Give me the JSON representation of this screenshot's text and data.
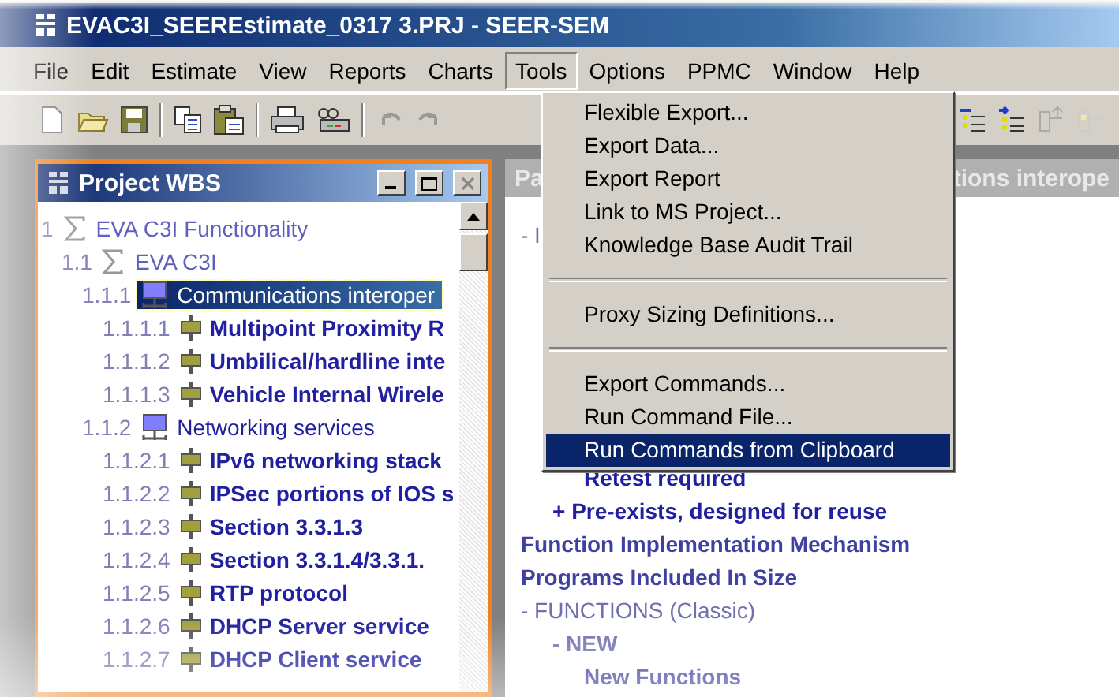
{
  "window": {
    "title": "EVAC3I_SEEREstimate_0317 3.PRJ - SEER-SEM"
  },
  "menu_bar": [
    {
      "label": "File",
      "selected": false
    },
    {
      "label": "Edit",
      "selected": false
    },
    {
      "label": "Estimate",
      "selected": false
    },
    {
      "label": "View",
      "selected": false
    },
    {
      "label": "Reports",
      "selected": false
    },
    {
      "label": "Charts",
      "selected": false
    },
    {
      "label": "Tools",
      "selected": true
    },
    {
      "label": "Options",
      "selected": false
    },
    {
      "label": "PPMC",
      "selected": false
    },
    {
      "label": "Window",
      "selected": false
    },
    {
      "label": "Help",
      "selected": false
    }
  ],
  "tools_menu": [
    {
      "kind": "item",
      "label": "Flexible Export...",
      "selected": false
    },
    {
      "kind": "item",
      "label": "Export Data...",
      "selected": false
    },
    {
      "kind": "item",
      "label": "Export Report",
      "selected": false
    },
    {
      "kind": "item",
      "label": "Link to MS Project...",
      "selected": false
    },
    {
      "kind": "item",
      "label": "Knowledge Base Audit Trail",
      "selected": false
    },
    {
      "kind": "separator"
    },
    {
      "kind": "item",
      "label": "Proxy Sizing Definitions...",
      "selected": false
    },
    {
      "kind": "separator"
    },
    {
      "kind": "item",
      "label": "Export Commands...",
      "selected": false
    },
    {
      "kind": "item",
      "label": "Run Command File...",
      "selected": false
    },
    {
      "kind": "item",
      "label": "Run Commands from Clipboard",
      "selected": true
    }
  ],
  "wbs_panel": {
    "title": "Project WBS",
    "tree": [
      {
        "number": "1",
        "label": "EVA C3I Functionality",
        "kind": "rollup",
        "selected": false,
        "children": [
          {
            "number": "1.1",
            "label": "EVA C3I",
            "kind": "rollup",
            "selected": false,
            "children": [
              {
                "number": "1.1.1",
                "label": "Communications interoper",
                "kind": "system",
                "selected": true,
                "children": [
                  {
                    "number": "1.1.1.1",
                    "label": "Multipoint Proximity R",
                    "kind": "module",
                    "selected": false
                  },
                  {
                    "number": "1.1.1.2",
                    "label": "Umbilical/hardline inte",
                    "kind": "module",
                    "selected": false
                  },
                  {
                    "number": "1.1.1.3",
                    "label": "Vehicle Internal Wirele",
                    "kind": "module",
                    "selected": false
                  }
                ]
              },
              {
                "number": "1.1.2",
                "label": "Networking services",
                "kind": "system",
                "selected": false,
                "children": [
                  {
                    "number": "1.1.2.1",
                    "label": "IPv6 networking stack",
                    "kind": "module",
                    "selected": false
                  },
                  {
                    "number": "1.1.2.2",
                    "label": "IPSec portions of IOS s",
                    "kind": "module",
                    "selected": false
                  },
                  {
                    "number": "1.1.2.3",
                    "label": "Section 3.3.1.3",
                    "kind": "module",
                    "selected": false
                  },
                  {
                    "number": "1.1.2.4",
                    "label": "Section 3.3.1.4/3.3.1.",
                    "kind": "module",
                    "selected": false
                  },
                  {
                    "number": "1.1.2.5",
                    "label": "RTP protocol",
                    "kind": "module",
                    "selected": false
                  },
                  {
                    "number": "1.1.2.6",
                    "label": "DHCP Server service",
                    "kind": "module",
                    "selected": false
                  },
                  {
                    "number": "1.1.2.7",
                    "label": "DHCP Client service",
                    "kind": "module",
                    "selected": false
                  }
                ]
              }
            ]
          }
        ]
      }
    ]
  },
  "parameters_panel": {
    "title_start": "Pa",
    "title_end": "tions interope",
    "items": [
      {
        "kind": "section",
        "text": "- I"
      },
      {
        "kind": "option",
        "text": "Retest required"
      },
      {
        "kind": "subgroup",
        "text": "+ Pre-exists, designed for reuse"
      },
      {
        "kind": "parameter",
        "text": "Function Implementation Mechanism"
      },
      {
        "kind": "parameter",
        "text": "Programs Included In Size"
      },
      {
        "kind": "section",
        "text": "- FUNCTIONS (Classic)",
        "children": [
          {
            "kind": "section",
            "text": "- NEW",
            "children": [
              {
                "kind": "parameter",
                "text": "New Functions"
              }
            ]
          }
        ]
      }
    ]
  }
}
